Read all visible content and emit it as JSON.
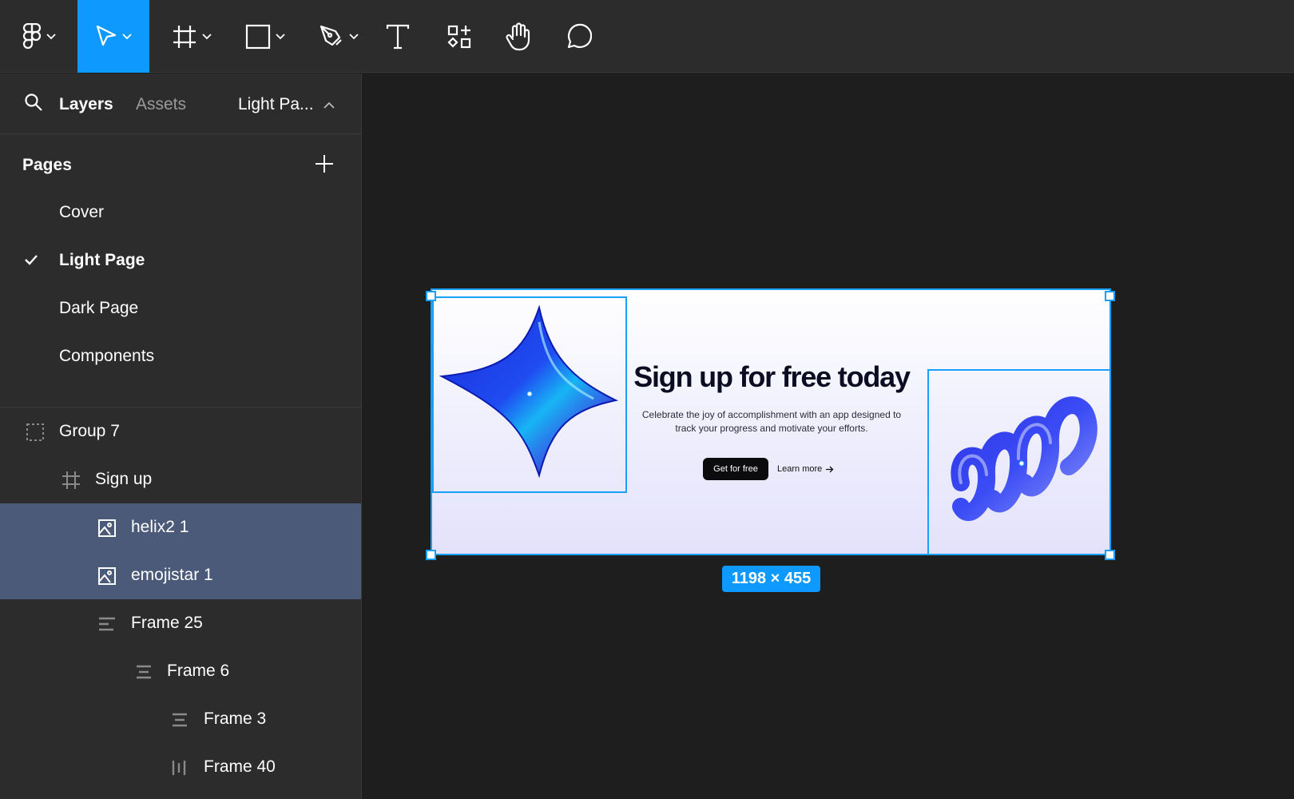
{
  "toolbar": {
    "tools": [
      {
        "name": "main-menu",
        "icon": "figma-logo-icon"
      },
      {
        "name": "move",
        "icon": "cursor-icon",
        "active": true
      },
      {
        "name": "frame",
        "icon": "frame-hash-icon"
      },
      {
        "name": "shape",
        "icon": "rectangle-icon"
      },
      {
        "name": "pen",
        "icon": "pen-icon"
      },
      {
        "name": "text",
        "icon": "text-icon"
      },
      {
        "name": "resources",
        "icon": "resources-icon"
      },
      {
        "name": "hand",
        "icon": "hand-icon"
      },
      {
        "name": "comment",
        "icon": "comment-icon"
      }
    ],
    "accent": "#0d99ff"
  },
  "sidebar": {
    "tabs": {
      "layers": "Layers",
      "assets": "Assets"
    },
    "current_page_short": "Light Pa...",
    "pages_title": "Pages",
    "pages": [
      {
        "label": "Cover"
      },
      {
        "label": "Light Page",
        "current": true
      },
      {
        "label": "Dark Page"
      },
      {
        "label": "Components"
      }
    ],
    "layers": [
      {
        "label": "Group 7",
        "icon": "group-icon"
      },
      {
        "label": "Sign up",
        "icon": "frame-icon"
      },
      {
        "label": "helix2 1",
        "icon": "image-icon",
        "selected": true
      },
      {
        "label": "emojistar 1",
        "icon": "image-icon",
        "selected": true
      },
      {
        "label": "Frame 25",
        "icon": "auto-layout-left-icon"
      },
      {
        "label": "Frame 6",
        "icon": "auto-layout-center-icon"
      },
      {
        "label": "Frame 3",
        "icon": "auto-layout-center-icon"
      },
      {
        "label": "Frame 40",
        "icon": "auto-layout-horizontal-icon"
      }
    ],
    "selected_color": "#4a5a78"
  },
  "canvas": {
    "banner": {
      "title": "Sign up for free today",
      "description": "Celebrate the joy of accomplishment with an app designed to track your progress and motivate your efforts.",
      "primary_button": "Get for free",
      "secondary_link": "Learn more"
    },
    "selection_size": "1198 × 455",
    "selection_color": "#18a0fb"
  }
}
